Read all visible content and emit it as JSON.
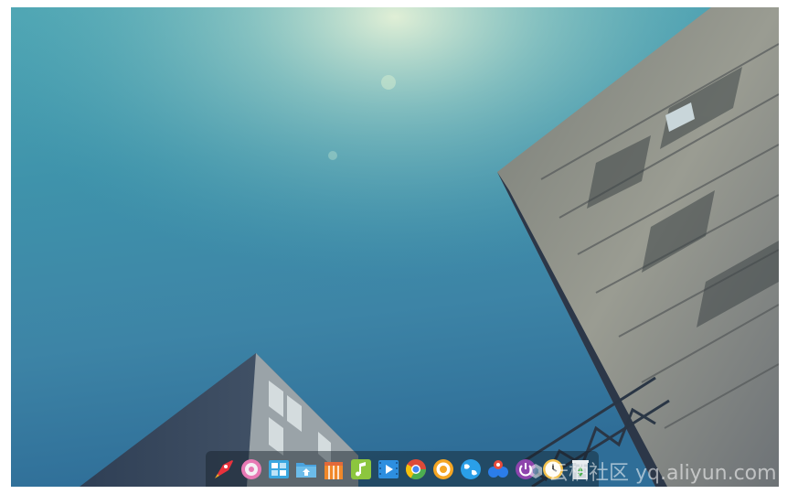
{
  "desktop": {
    "dock": {
      "items": [
        {
          "icon": "launcher-rocket-icon",
          "color": "#e8323c"
        },
        {
          "icon": "settings-gear-icon",
          "color": "#e879b4"
        },
        {
          "icon": "app-store-icon",
          "color": "#3aa7e0"
        },
        {
          "icon": "file-manager-icon",
          "color": "#4aa3df"
        },
        {
          "icon": "deepin-store-icon",
          "color": "#f0882a"
        },
        {
          "icon": "music-player-icon",
          "color": "#8cc63e"
        },
        {
          "icon": "video-player-icon",
          "color": "#2d8fe0"
        },
        {
          "icon": "chrome-browser-icon",
          "color": "#dd4b39"
        },
        {
          "icon": "browser-icon",
          "color": "#f5a623"
        },
        {
          "icon": "globe-browser-icon",
          "color": "#2a9fe8"
        },
        {
          "icon": "chat-app-icon",
          "color": "#2b7de9"
        },
        {
          "icon": "power-icon",
          "color": "#8e44ad"
        },
        {
          "icon": "clock-icon",
          "color": "#f2c14e"
        },
        {
          "icon": "trash-icon",
          "color": "#cfd6dc"
        }
      ]
    },
    "watermark": {
      "text": "云栖社区 yq.aliyun.com"
    }
  }
}
